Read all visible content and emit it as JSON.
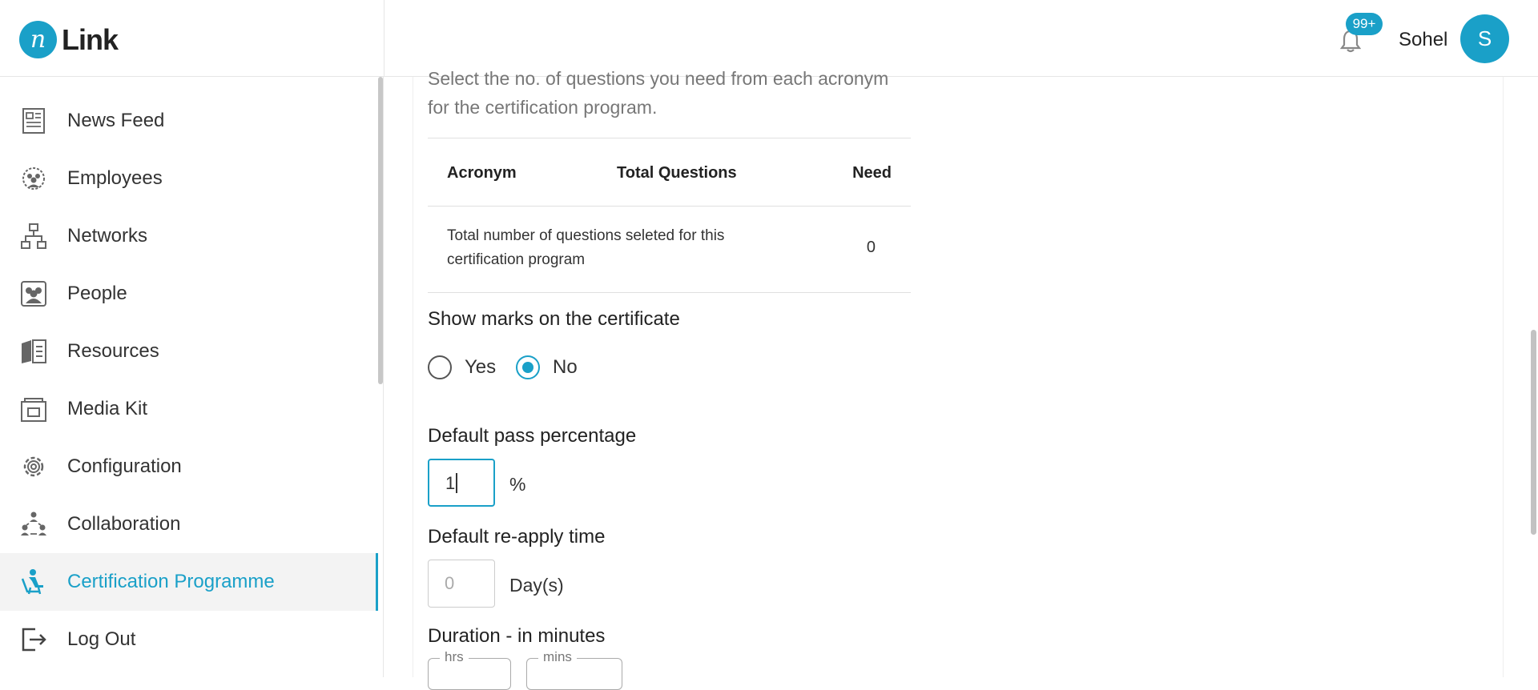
{
  "brand": {
    "logo_mark": "n",
    "logo_text": "Link"
  },
  "header": {
    "notification_badge": "99+",
    "user_name": "Sohel",
    "avatar_initial": "S"
  },
  "sidebar": {
    "items": [
      {
        "label": "News Feed",
        "icon": "news-feed-icon"
      },
      {
        "label": "Employees",
        "icon": "employees-icon"
      },
      {
        "label": "Networks",
        "icon": "networks-icon"
      },
      {
        "label": "People",
        "icon": "people-icon"
      },
      {
        "label": "Resources",
        "icon": "resources-icon"
      },
      {
        "label": "Media Kit",
        "icon": "media-kit-icon"
      },
      {
        "label": "Configuration",
        "icon": "gear-icon"
      },
      {
        "label": "Collaboration",
        "icon": "collaboration-icon"
      },
      {
        "label": "Certification Programme",
        "icon": "certification-icon",
        "active": true
      },
      {
        "label": "Log Out",
        "icon": "logout-icon"
      }
    ]
  },
  "main": {
    "intro_text": "Select the no. of questions you need from each acronym for the certification program.",
    "table": {
      "headers": [
        "Acronym",
        "Total Questions",
        "Need"
      ],
      "total_row_label": "Total number of questions seleted for this certification program",
      "total_row_value": "0"
    },
    "show_marks": {
      "label": "Show marks on the certificate",
      "options": [
        "Yes",
        "No"
      ],
      "selected": "No"
    },
    "pass_percentage": {
      "label": "Default pass percentage",
      "value": "1",
      "unit": "%"
    },
    "reapply": {
      "label": "Default re-apply time",
      "placeholder": "0",
      "unit": "Day(s)"
    },
    "duration": {
      "label": "Duration - in minutes",
      "hrs_label": "hrs",
      "mins_label": "mins"
    }
  },
  "colors": {
    "accent": "#1aa0c8"
  }
}
